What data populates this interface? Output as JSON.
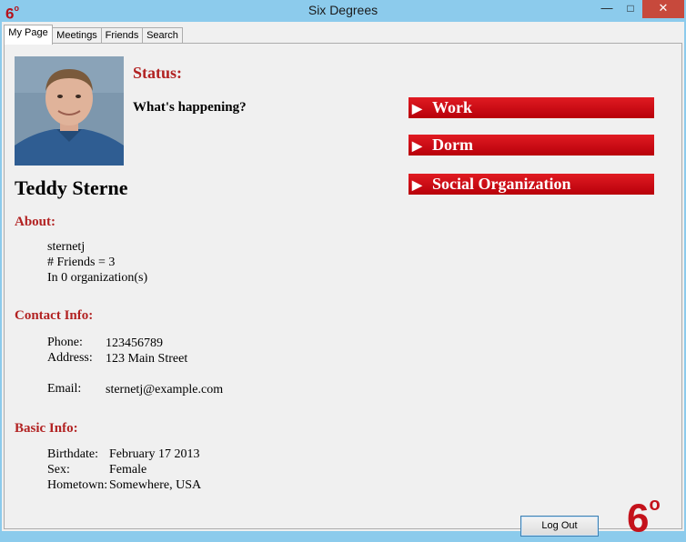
{
  "window": {
    "title": "Six Degrees",
    "icon_text": "6",
    "icon_deg": "o",
    "minimize": "—",
    "maximize": "□",
    "close": "✕"
  },
  "tabs": [
    {
      "label": "My Page"
    },
    {
      "label": "Meetings"
    },
    {
      "label": "Friends"
    },
    {
      "label": "Search"
    }
  ],
  "profile": {
    "status_label": "Status:",
    "status_text": "What's happening?",
    "name": "Teddy Sterne",
    "about": {
      "heading": "About:",
      "username": "sternetj",
      "friends": "# Friends = 3",
      "orgs": "In 0 organization(s)"
    },
    "contact": {
      "heading": "Contact Info:",
      "phone_label": "Phone:",
      "phone": "123456789",
      "address_label": "Address:",
      "address": "123 Main Street",
      "email_label": "Email:",
      "email": "sternetj@example.com"
    },
    "basic": {
      "heading": "Basic Info:",
      "birthdate_label": "Birthdate:",
      "birthdate": "February 17 2013",
      "sex_label": "Sex:",
      "sex": "Female",
      "hometown_label": "Hometown:",
      "hometown": "Somewhere, USA"
    }
  },
  "categories": {
    "work": "Work",
    "dorm": "Dorm",
    "social": "Social Organization",
    "arrow": "▶"
  },
  "logout_label": "Log Out",
  "logo": {
    "text": "6",
    "deg": "o"
  },
  "colors": {
    "titlebar": "#8ccbec",
    "accent_red": "#b22222",
    "button_red": "#d0101a",
    "close": "#c7493c"
  }
}
